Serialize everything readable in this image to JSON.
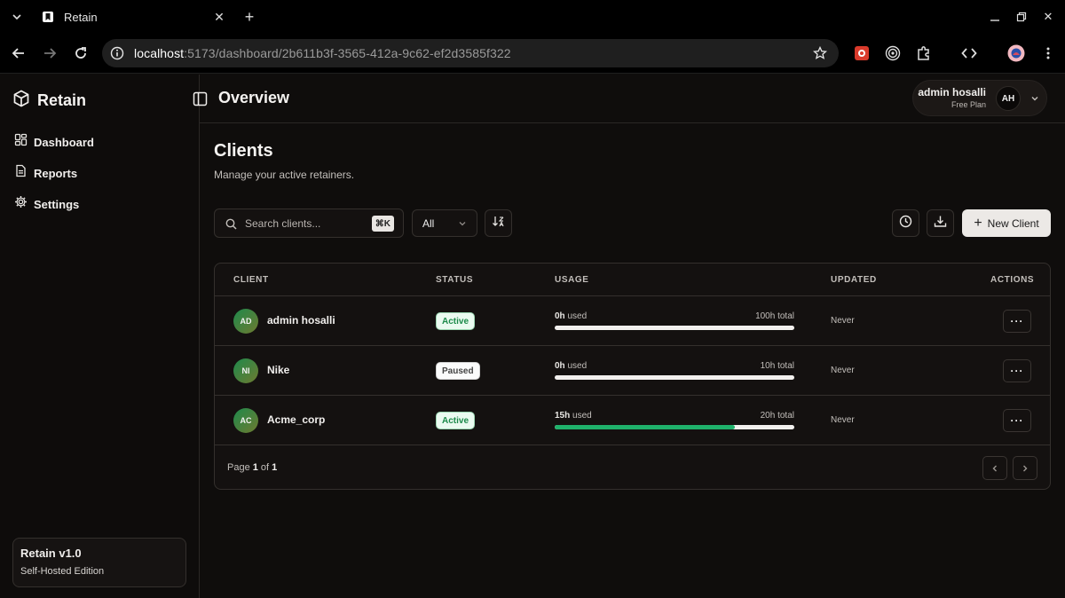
{
  "browser": {
    "tab_title": "Retain",
    "url_host": "localhost",
    "url_rest": ":5173/dashboard/2b611b3f-3565-412a-9c62-ef2d3585f322"
  },
  "sidebar": {
    "brand": "Retain",
    "items": [
      {
        "label": "Dashboard",
        "icon": "dashboard-icon"
      },
      {
        "label": "Reports",
        "icon": "file-icon"
      },
      {
        "label": "Settings",
        "icon": "gear-icon"
      }
    ],
    "footer": {
      "title": "Retain v1.0",
      "subtitle": "Self-Hosted Edition"
    }
  },
  "header": {
    "title": "Overview",
    "user": {
      "name": "admin hosalli",
      "plan": "Free Plan",
      "initials": "AH"
    }
  },
  "clients_section": {
    "title": "Clients",
    "subtitle": "Manage your active retainers.",
    "search": {
      "placeholder": "Search clients...",
      "shortcut": "⌘K"
    },
    "filter": {
      "value": "All"
    },
    "new_client_label": "New Client"
  },
  "table": {
    "columns": [
      "CLIENT",
      "STATUS",
      "USAGE",
      "UPDATED",
      "ACTIONS"
    ],
    "rows": [
      {
        "initials": "AD",
        "name": "admin hosalli",
        "status": "Active",
        "used": "0h",
        "used_suffix": " used",
        "total": "100h total",
        "used_fraction": 0.0,
        "updated": "Never"
      },
      {
        "initials": "NI",
        "name": "Nike",
        "status": "Paused",
        "used": "0h",
        "used_suffix": " used",
        "total": "10h total",
        "used_fraction": 0.0,
        "updated": "Never"
      },
      {
        "initials": "AC",
        "name": "Acme_corp",
        "status": "Active",
        "used": "15h",
        "used_suffix": " used",
        "total": "20h total",
        "used_fraction": 0.75,
        "updated": "Never"
      }
    ],
    "pagination": {
      "prefix": "Page ",
      "current": "1",
      "middle": " of ",
      "total": "1"
    }
  },
  "colors": {
    "accent_green": "#1fb26b",
    "background": "#0f0d0c"
  }
}
